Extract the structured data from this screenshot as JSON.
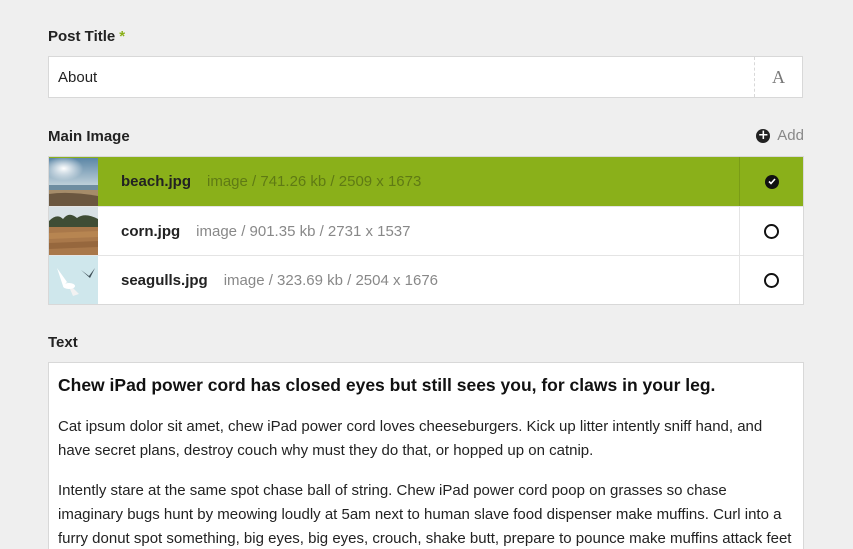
{
  "post_title": {
    "label": "Post Title",
    "required_mark": "*",
    "value": "About",
    "typography_button": "A"
  },
  "main_image": {
    "label": "Main Image",
    "add_label": "Add",
    "add_icon": "plus-circle-icon",
    "images": [
      {
        "filename": "beach.jpg",
        "meta": "image / 741.26 kb / 2509 x 1673",
        "selected": true
      },
      {
        "filename": "corn.jpg",
        "meta": "image / 901.35 kb / 2731 x 1537",
        "selected": false
      },
      {
        "filename": "seagulls.jpg",
        "meta": "image / 323.69 kb / 2504 x 1676",
        "selected": false
      }
    ]
  },
  "text": {
    "label": "Text",
    "heading": "Chew iPad power cord has closed eyes but still sees you, for claws in your leg.",
    "paragraphs": [
      "Cat ipsum dolor sit amet, chew iPad power cord loves cheeseburgers. Kick up litter intently sniff hand, and have secret plans, destroy couch why must they do that, or hopped up on catnip.",
      "Intently stare at the same spot chase ball of string. Chew iPad power cord poop on grasses so chase imaginary bugs hunt by meowing loudly at 5am next to human slave food dispenser make muffins. Curl into a furry donut spot something, big eyes, big eyes, crouch, shake butt, prepare to pounce make muffins attack feet destroy"
    ]
  },
  "colors": {
    "accent": "#8ab01a",
    "background": "#efefef",
    "muted_text": "#888888"
  }
}
